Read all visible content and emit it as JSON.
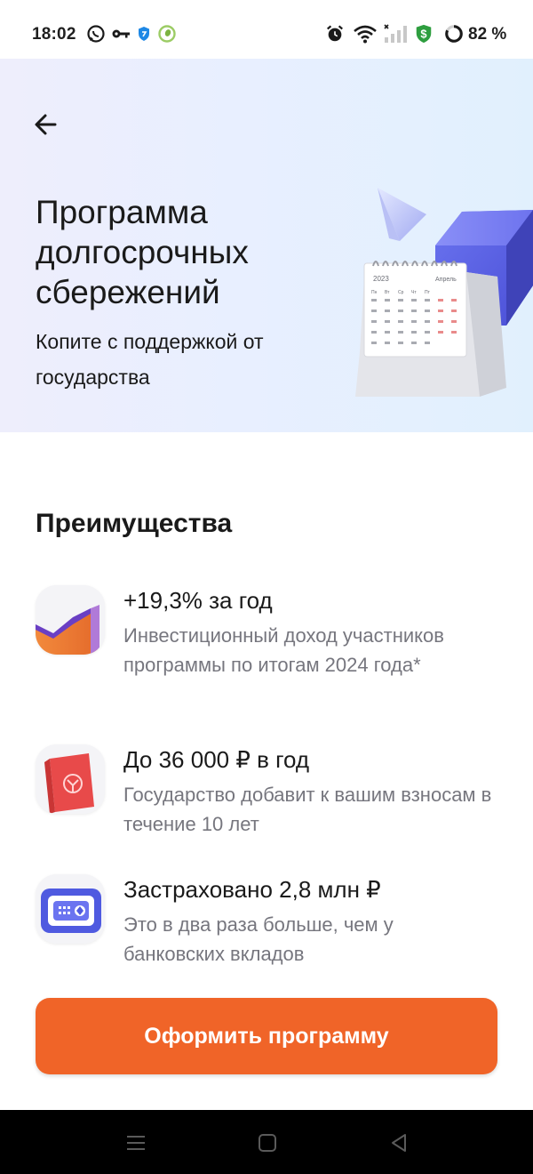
{
  "status_bar": {
    "time": "18:02",
    "battery_percent": "82 %",
    "battery_level": 0.82,
    "notification_icons": [
      "whatsapp-icon",
      "key-icon",
      "shield-icon",
      "app-icon"
    ],
    "system_icons": [
      "alarm-icon",
      "wifi-icon",
      "signal-icon",
      "security-icon",
      "battery-ring-icon"
    ]
  },
  "hero": {
    "title": "Программа долгосрочных сбережений",
    "subtitle": "Копите с поддержкой от государства",
    "back_icon": "arrow-left-icon",
    "illustration": {
      "calendar_year": "2023",
      "calendar_month": "Апрель",
      "weekdays": [
        "Пн",
        "Вт",
        "Ср",
        "Чт",
        "Пт"
      ]
    }
  },
  "advantages": {
    "title": "Преимущества",
    "items": [
      {
        "icon": "growth-chart-icon",
        "title": "+19,3% за год",
        "description": "Инвестиционный доход участников программы по итогам 2024 года*"
      },
      {
        "icon": "state-document-icon",
        "title": "До 36 000 ₽ в год",
        "description": "Государство добавит к вашим взносам в течение 10 лет"
      },
      {
        "icon": "safe-icon",
        "title": "Застраховано 2,8 млн ₽",
        "description": "Это в два раза больше, чем у банковских вкладов"
      }
    ]
  },
  "cta": {
    "label": "Оформить программу"
  },
  "nav_bar": {
    "buttons": [
      "menu-icon",
      "home-icon",
      "back-triangle-icon"
    ]
  },
  "colors": {
    "accent": "#f06428",
    "hero_bg": "#e8efff",
    "text_primary": "#1a1a1a",
    "text_secondary": "#76767e",
    "nav_bg": "#000000"
  }
}
